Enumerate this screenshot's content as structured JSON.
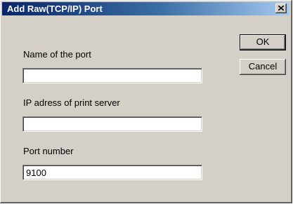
{
  "window": {
    "title": "Add Raw(TCP/IP) Port"
  },
  "buttons": {
    "ok_label": "OK",
    "cancel_label": "Cancel"
  },
  "form": {
    "port_name_label": "Name of the port",
    "port_name_value": "",
    "ip_label": "IP adress of print server",
    "ip_value": "",
    "port_number_label": "Port number",
    "port_number_value": "9100"
  },
  "icons": {
    "close": "close-icon"
  }
}
